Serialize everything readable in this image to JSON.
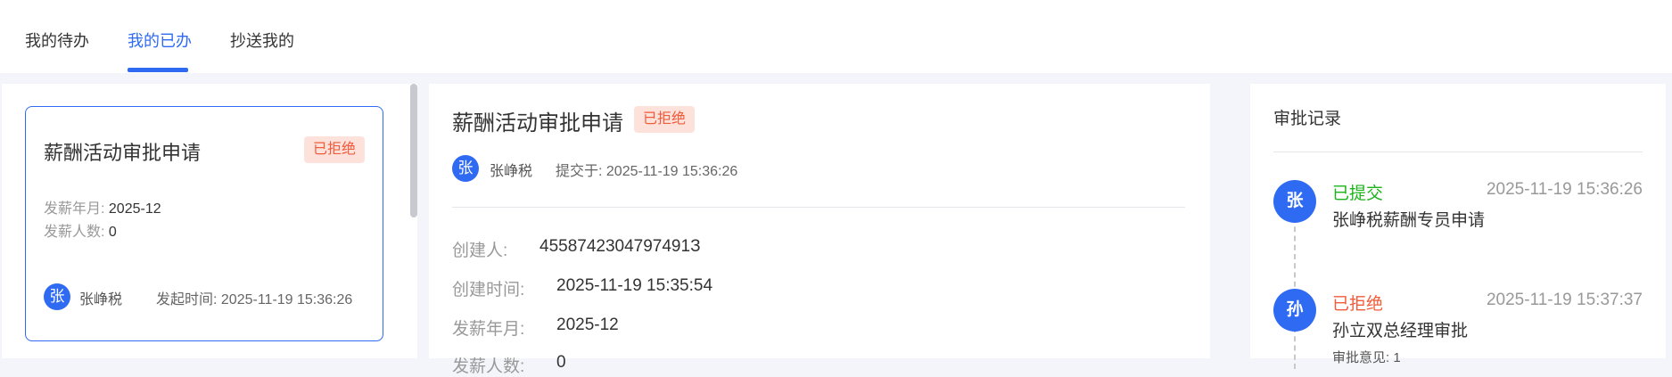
{
  "tabs": [
    {
      "label": "我的待办"
    },
    {
      "label": "我的已办"
    },
    {
      "label": "抄送我的"
    }
  ],
  "card": {
    "title": "薪酬活动审批申请",
    "status": "已拒绝",
    "month_label": "发薪年月:",
    "month_value": "2025-12",
    "count_label": "发薪人数:",
    "count_value": "0",
    "avatar_char": "张",
    "user": "张峥税",
    "time_label": "发起时间:",
    "time_value": "2025-11-19 15:36:26"
  },
  "detail": {
    "title": "薪酬活动审批申请",
    "status": "已拒绝",
    "avatar_char": "张",
    "user": "张峥税",
    "submit_label": "提交于:",
    "submit_time": "2025-11-19 15:36:26",
    "fields": [
      {
        "label": "创建人:",
        "value": "4558742304797491З"
      },
      {
        "label": "创建时间:",
        "value": "2025-11-19 15:35:54"
      },
      {
        "label": "发薪年月:",
        "value": "2025-12"
      },
      {
        "label": "发薪人数:",
        "value": "0"
      }
    ]
  },
  "record": {
    "title": "审批记录",
    "items": [
      {
        "avatar_char": "张",
        "status": "已提交",
        "status_color": "#1bb31b",
        "time": "2025-11-19 15:36:26",
        "desc": "张峥税薪酬专员申请",
        "opinion": ""
      },
      {
        "avatar_char": "孙",
        "status": "已拒绝",
        "status_color": "#f15b3a",
        "time": "2025-11-19 15:37:37",
        "desc": "孙立双总经理审批",
        "opinion": "审批意见: 1"
      }
    ]
  },
  "colors": {
    "accent": "#2f6bf2",
    "rejected": "#f15b3a",
    "submitted": "#1bb31b"
  }
}
